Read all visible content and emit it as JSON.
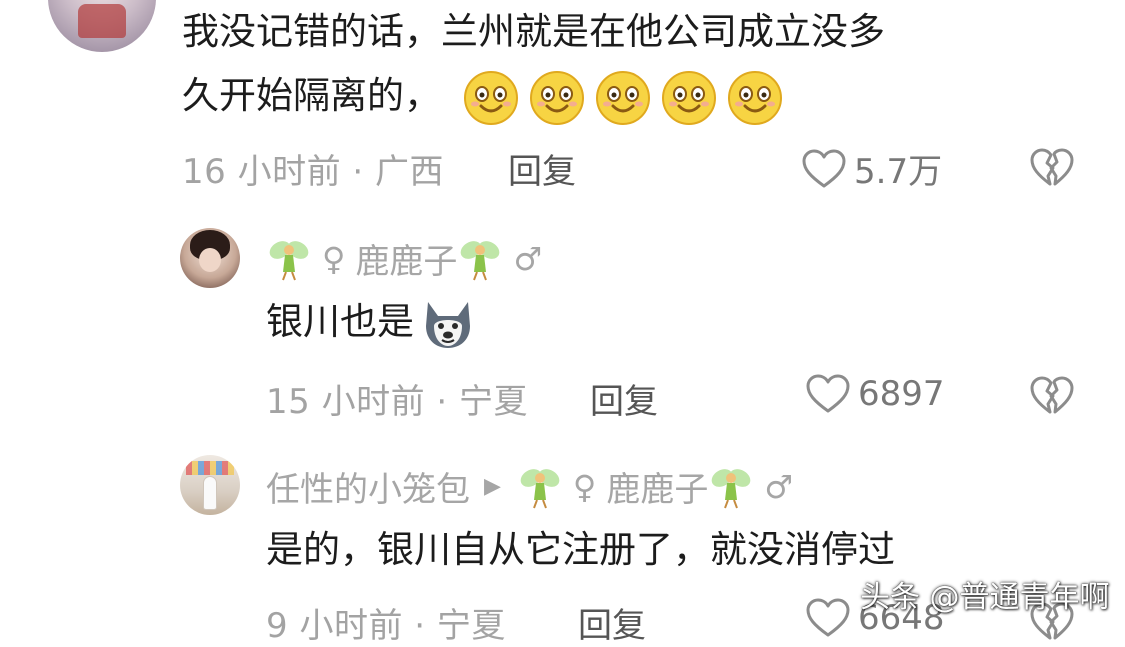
{
  "comments": [
    {
      "text_line1": "我没记错的话，兰州就是在他公司成立没多",
      "text_line2": "久开始隔离的，",
      "emoji_count_icon": "grinning-sweat-face-icon",
      "time": "16 小时前",
      "region": "广西",
      "reply_label": "回复",
      "likes": "5.7万"
    }
  ],
  "replies": [
    {
      "sender": "鹿鹿子",
      "sender_gender": "♀",
      "receiver_gender": "♂",
      "text": "银川也是",
      "time": "15 小时前",
      "region": "宁夏",
      "reply_label": "回复",
      "likes": "6897"
    },
    {
      "sender": "任性的小笼包",
      "receiver": "鹿鹿子",
      "receiver_gender_a": "♀",
      "receiver_gender_b": "♂",
      "text": "是的，银川自从它注册了，就没消停过",
      "time": "9 小时前",
      "region": "宁夏",
      "reply_label": "回复",
      "likes": "6648"
    }
  ],
  "separator": "·",
  "watermark": "头条 @普通青年啊"
}
